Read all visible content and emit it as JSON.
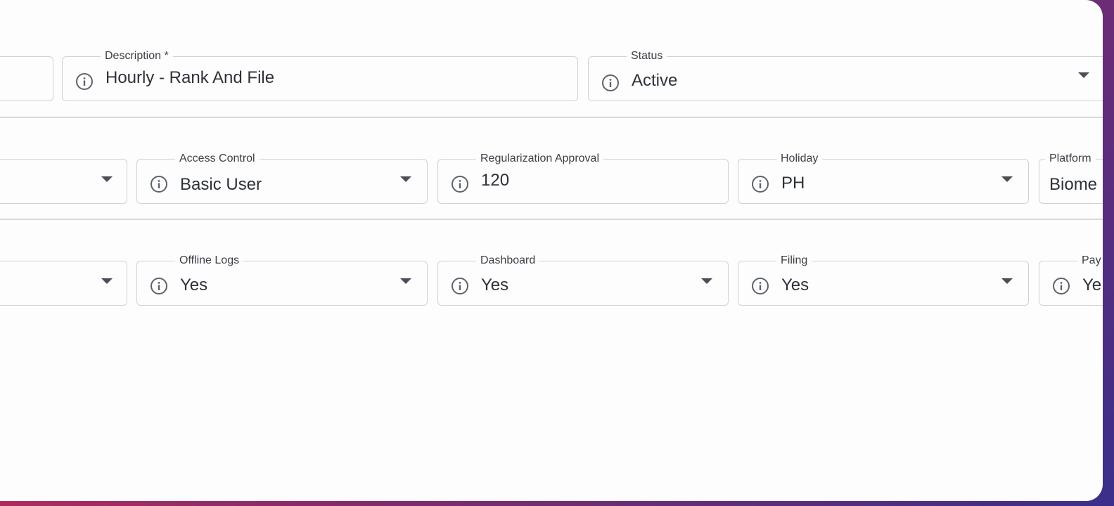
{
  "row1": {
    "description": {
      "label": "Description *",
      "value": "Hourly - Rank And File"
    },
    "status": {
      "label": "Status",
      "value": "Active"
    }
  },
  "row2": {
    "access_control": {
      "label": "Access Control",
      "value": "Basic User"
    },
    "regularization": {
      "label": "Regularization Approval",
      "value": "120"
    },
    "holiday": {
      "label": "Holiday",
      "value": "PH"
    },
    "platform": {
      "label": "Platform",
      "value": "Biome"
    }
  },
  "row3": {
    "offline_logs": {
      "label": "Offline Logs",
      "value": "Yes"
    },
    "dashboard": {
      "label": "Dashboard",
      "value": "Yes"
    },
    "filing": {
      "label": "Filing",
      "value": "Yes"
    },
    "pay": {
      "label": "Pay",
      "value": "Ye"
    }
  },
  "icons": [
    "info-icon",
    "dropdown-caret-icon"
  ]
}
